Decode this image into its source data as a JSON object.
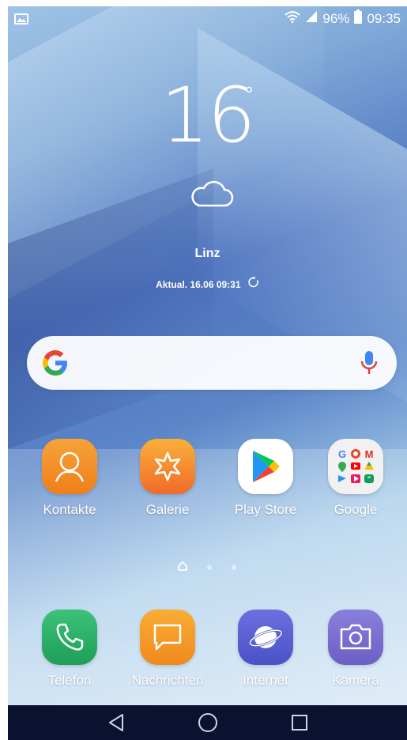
{
  "status_bar": {
    "battery": "96%",
    "time": "09:35",
    "icons": [
      "gallery-notification-icon",
      "wifi-icon",
      "signal-icon",
      "battery-icon"
    ]
  },
  "weather": {
    "temperature": "16",
    "degree_symbol": "°",
    "condition_icon": "cloud-icon",
    "city": "Linz",
    "updated": "Aktual. 16.06 09:31",
    "refresh_icon": "refresh-icon"
  },
  "search": {
    "logo_icon": "google-g-icon",
    "voice_icon": "microphone-icon"
  },
  "apps": [
    {
      "label": "Kontakte",
      "icon": "contacts-icon"
    },
    {
      "label": "Galerie",
      "icon": "gallery-icon"
    },
    {
      "label": "Play Store",
      "icon": "play-store-icon"
    },
    {
      "label": "Google",
      "icon": "google-folder-icon"
    }
  ],
  "dock": [
    {
      "label": "Telefon",
      "icon": "phone-icon"
    },
    {
      "label": "Nachrichten",
      "icon": "messages-icon"
    },
    {
      "label": "Internet",
      "icon": "internet-icon"
    },
    {
      "label": "Kamera",
      "icon": "camera-icon"
    }
  ],
  "navigation": {
    "back_icon": "back-icon",
    "home_icon": "home-icon",
    "recents_icon": "recents-icon"
  },
  "colors": {
    "contacts": "#f5922a",
    "gallery": "#f79a2c",
    "play_store_bg": "#ffffff",
    "folder_bg": "#f1f1f1",
    "phone": "#2db36b",
    "messages": "#f6a028",
    "internet": "#5b63d8",
    "camera": "#7a6fcf"
  }
}
